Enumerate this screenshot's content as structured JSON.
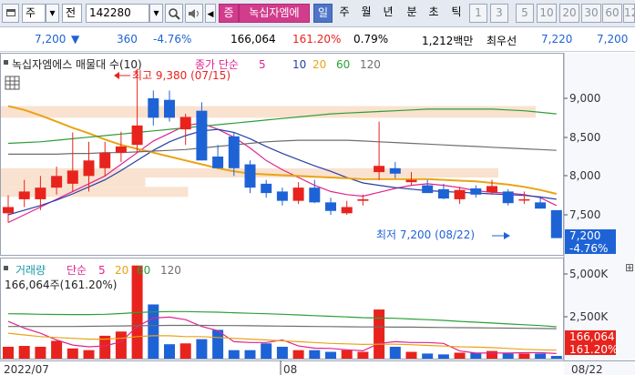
{
  "toolbar": {
    "market": "주",
    "kind": "전",
    "code": "142280",
    "search_icon": "magnifier-icon",
    "speaker_icon": "speaker-icon",
    "prev_icon": "previous-arrow-icon",
    "badge": "증",
    "name": "녹십자엠에",
    "periods": [
      "일",
      "주",
      "월",
      "년",
      "분",
      "초",
      "틱"
    ],
    "intervals": [
      "1",
      "3",
      "5",
      "10",
      "20",
      "30",
      "60",
      "12"
    ]
  },
  "info": {
    "price": "7,200",
    "down_arrow": "▼",
    "change": "360",
    "change_pct": "-4.76%",
    "volume": "166,064",
    "volume_ratio": "161.20%",
    "turnover": "0.79%",
    "amount": "1,212백만",
    "best_label": "최우선",
    "ask": "7,220",
    "bid": "7,200"
  },
  "colors": {
    "up": "#e8231d",
    "down": "#1e63d6",
    "ma5": "#e0248f",
    "ma10": "#2740a6",
    "ma20": "#eaa315",
    "ma60": "#2e9e3a",
    "ma120": "#6e6e6e"
  },
  "chart_data": [
    {
      "type": "candlestick",
      "title": "녹십자엠에스 매물대 수(10)",
      "legend": {
        "label": "종가 단순",
        "periods": [
          "5",
          "10",
          "20",
          "60",
          "120"
        ]
      },
      "ylim": [
        7200,
        9380
      ],
      "yticks": [
        "9,000",
        "8,500",
        "8,000",
        "7,500"
      ],
      "x_labels": [
        "2022/07",
        "08",
        "08/22"
      ],
      "current_price_label": "7,200",
      "current_change_label": "-4.76%",
      "annotations": {
        "high": "최고 9,380 (07/15)",
        "low": "최저 7,200 (08/22)"
      },
      "candles": [
        {
          "o": 7520,
          "h": 7750,
          "l": 7400,
          "c": 7600
        },
        {
          "o": 7700,
          "h": 7950,
          "l": 7600,
          "c": 7800
        },
        {
          "o": 7700,
          "h": 8000,
          "l": 7560,
          "c": 7850
        },
        {
          "o": 7850,
          "h": 8120,
          "l": 7760,
          "c": 8000
        },
        {
          "o": 7900,
          "h": 8560,
          "l": 7800,
          "c": 8070
        },
        {
          "o": 8000,
          "h": 8440,
          "l": 7800,
          "c": 8200
        },
        {
          "o": 8100,
          "h": 8440,
          "l": 8000,
          "c": 8300
        },
        {
          "o": 8300,
          "h": 8570,
          "l": 8180,
          "c": 8380
        },
        {
          "o": 8400,
          "h": 9380,
          "l": 8300,
          "c": 8650
        },
        {
          "o": 9000,
          "h": 9100,
          "l": 8650,
          "c": 8750
        },
        {
          "o": 8980,
          "h": 9100,
          "l": 8700,
          "c": 8750
        },
        {
          "o": 8600,
          "h": 8800,
          "l": 8400,
          "c": 8760
        },
        {
          "o": 8840,
          "h": 8950,
          "l": 8200,
          "c": 8200
        },
        {
          "o": 8250,
          "h": 8400,
          "l": 8100,
          "c": 8100
        },
        {
          "o": 8510,
          "h": 8560,
          "l": 8000,
          "c": 8100
        },
        {
          "o": 8150,
          "h": 8200,
          "l": 7780,
          "c": 7850
        },
        {
          "o": 7900,
          "h": 7950,
          "l": 7720,
          "c": 7780
        },
        {
          "o": 7800,
          "h": 7850,
          "l": 7620,
          "c": 7680
        },
        {
          "o": 7680,
          "h": 7920,
          "l": 7640,
          "c": 7850
        },
        {
          "o": 7850,
          "h": 7950,
          "l": 7650,
          "c": 7660
        },
        {
          "o": 7660,
          "h": 7720,
          "l": 7500,
          "c": 7550
        },
        {
          "o": 7520,
          "h": 7680,
          "l": 7500,
          "c": 7600
        },
        {
          "o": 7680,
          "h": 7760,
          "l": 7620,
          "c": 7700
        },
        {
          "o": 8050,
          "h": 8700,
          "l": 7950,
          "c": 8130
        },
        {
          "o": 8100,
          "h": 8180,
          "l": 7970,
          "c": 8030
        },
        {
          "o": 7920,
          "h": 8050,
          "l": 7880,
          "c": 7950
        },
        {
          "o": 7880,
          "h": 7950,
          "l": 7780,
          "c": 7780
        },
        {
          "o": 7830,
          "h": 7900,
          "l": 7700,
          "c": 7710
        },
        {
          "o": 7700,
          "h": 7860,
          "l": 7640,
          "c": 7820
        },
        {
          "o": 7840,
          "h": 7880,
          "l": 7720,
          "c": 7760
        },
        {
          "o": 7790,
          "h": 7950,
          "l": 7760,
          "c": 7870
        },
        {
          "o": 7800,
          "h": 7830,
          "l": 7620,
          "c": 7650
        },
        {
          "o": 7700,
          "h": 7800,
          "l": 7640,
          "c": 7700
        },
        {
          "o": 7660,
          "h": 7740,
          "l": 7580,
          "c": 7580
        },
        {
          "o": 7560,
          "h": 7560,
          "l": 7200,
          "c": 7200
        }
      ],
      "ma_series": [
        {
          "name": "5",
          "values": [
            7400,
            7500,
            7600,
            7700,
            7800,
            7900,
            8000,
            8150,
            8300,
            8450,
            8550,
            8650,
            8680,
            8600,
            8500,
            8360,
            8200,
            8080,
            7980,
            7880,
            7800,
            7760,
            7740,
            7790,
            7840,
            7880,
            7900,
            7880,
            7850,
            7810,
            7790,
            7780,
            7760,
            7720,
            7620
          ]
        },
        {
          "name": "10",
          "values": [
            7500,
            7560,
            7620,
            7690,
            7770,
            7860,
            7950,
            8070,
            8200,
            8330,
            8440,
            8520,
            8580,
            8600,
            8560,
            8480,
            8380,
            8290,
            8210,
            8130,
            8060,
            7980,
            7910,
            7880,
            7850,
            7830,
            7810,
            7800,
            7790,
            7780,
            7770,
            7760,
            7750,
            7730,
            7700
          ]
        },
        {
          "name": "20",
          "values": [
            8900,
            8850,
            8780,
            8700,
            8620,
            8550,
            8470,
            8400,
            8350,
            8300,
            8250,
            8200,
            8150,
            8100,
            8060,
            8030,
            8020,
            8010,
            8000,
            7990,
            7980,
            7970,
            7960,
            7960,
            7960,
            7960,
            7960,
            7950,
            7940,
            7930,
            7910,
            7890,
            7860,
            7820,
            7770
          ]
        },
        {
          "name": "60",
          "values": [
            8420,
            8430,
            8440,
            8460,
            8480,
            8500,
            8520,
            8540,
            8560,
            8580,
            8600,
            8620,
            8640,
            8660,
            8680,
            8700,
            8720,
            8740,
            8760,
            8780,
            8800,
            8810,
            8820,
            8830,
            8840,
            8850,
            8860,
            8860,
            8860,
            8860,
            8860,
            8850,
            8840,
            8820,
            8800
          ]
        },
        {
          "name": "120",
          "values": [
            8280,
            8280,
            8280,
            8280,
            8290,
            8290,
            8300,
            8300,
            8310,
            8320,
            8330,
            8340,
            8360,
            8380,
            8400,
            8420,
            8440,
            8450,
            8460,
            8460,
            8460,
            8460,
            8450,
            8440,
            8430,
            8420,
            8410,
            8400,
            8390,
            8380,
            8370,
            8360,
            8350,
            8340,
            8330
          ]
        }
      ],
      "volume_profile": [
        {
          "from": 8900,
          "to": 8750,
          "share": 1.0
        },
        {
          "from": 8100,
          "to": 7980,
          "share": 0.93
        },
        {
          "from": 7980,
          "to": 7860,
          "share": 0.27
        },
        {
          "from": 7860,
          "to": 7730,
          "share": 0.35
        }
      ]
    },
    {
      "type": "bar",
      "title": "거래량",
      "legend": {
        "label": "단순",
        "periods": [
          "5",
          "20",
          "60",
          "120"
        ]
      },
      "info_label": "166,064주(161.20%)",
      "ylim": [
        0,
        6000
      ],
      "ylabel_unit": "K",
      "yticks": [
        "5,000K",
        "2,500K"
      ],
      "current_volume_label": "166,064",
      "current_ratio_label": "161.20%",
      "values": [
        700,
        750,
        700,
        1050,
        600,
        500,
        1350,
        1600,
        5500,
        3200,
        850,
        900,
        1150,
        1700,
        500,
        500,
        900,
        700,
        500,
        500,
        400,
        500,
        400,
        2900,
        700,
        400,
        300,
        250,
        350,
        350,
        450,
        300,
        300,
        300,
        160
      ],
      "ma_series": [
        {
          "name": "5",
          "values": [
            2200,
            1800,
            1500,
            1100,
            800,
            700,
            750,
            1000,
            1900,
            2400,
            2450,
            2300,
            1900,
            1650,
            1000,
            950,
            950,
            1100,
            750,
            620,
            600,
            520,
            460,
            900,
            1000,
            950,
            950,
            900,
            450,
            330,
            330,
            330,
            350,
            350,
            300
          ]
        },
        {
          "name": "20",
          "values": [
            1500,
            1400,
            1300,
            1250,
            1200,
            1150,
            1150,
            1200,
            1300,
            1350,
            1350,
            1300,
            1300,
            1250,
            1200,
            1150,
            1100,
            1050,
            1000,
            950,
            900,
            870,
            840,
            850,
            850,
            820,
            780,
            740,
            700,
            680,
            650,
            600,
            550,
            520,
            500
          ]
        },
        {
          "name": "60",
          "values": [
            2650,
            2640,
            2620,
            2610,
            2600,
            2600,
            2620,
            2660,
            2720,
            2760,
            2780,
            2780,
            2760,
            2740,
            2710,
            2680,
            2650,
            2620,
            2580,
            2540,
            2500,
            2460,
            2420,
            2400,
            2380,
            2340,
            2300,
            2260,
            2200,
            2150,
            2100,
            2050,
            2000,
            1950,
            1880
          ]
        },
        {
          "name": "120",
          "values": [
            1900,
            1900,
            1900,
            1900,
            1900,
            1910,
            1920,
            1930,
            1940,
            1950,
            1960,
            1960,
            1960,
            1950,
            1950,
            1940,
            1930,
            1920,
            1910,
            1900,
            1890,
            1880,
            1870,
            1870,
            1860,
            1860,
            1850,
            1840,
            1830,
            1820,
            1810,
            1800,
            1790,
            1780,
            1770
          ]
        }
      ]
    }
  ]
}
